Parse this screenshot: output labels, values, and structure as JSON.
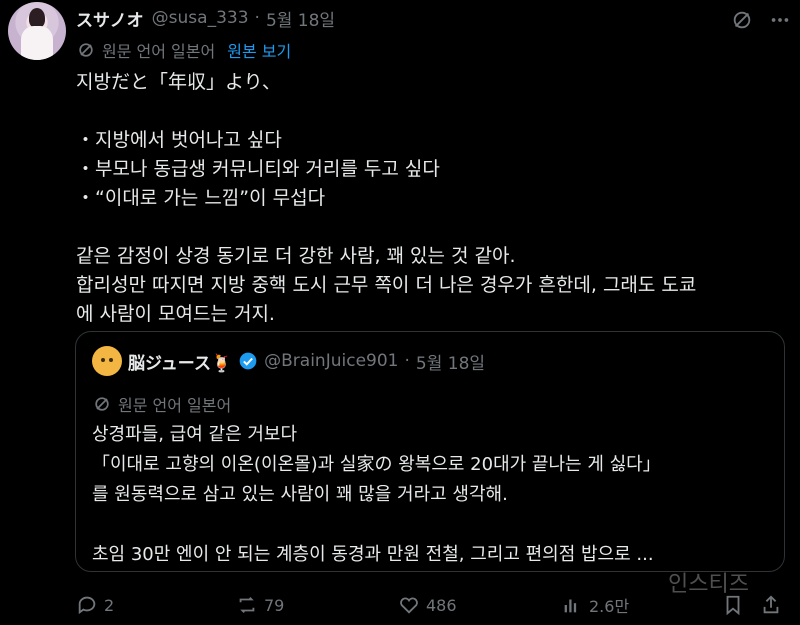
{
  "post": {
    "author_name": "スサノオ",
    "handle": "@susa_333",
    "separator": "·",
    "date": "5월 18일",
    "translate_label": "원문 언어 일본어",
    "view_original": "원본 보기",
    "text": "지방だと「年収」より、\n\n・지방에서 벗어나고 싶다\n・부모나 동급생 커뮤니티와 거리를 두고 싶다\n・“이대로 가는 느낌”이 무섭다\n\n같은 감정이 상경 동기로 더 강한 사람, 꽤 있는 것 같아.\n합리성만 따지면 지방 중핵 도시 근무 쪽이 더 나은 경우가 흔한데, 그래도 도쿄\n에 사람이 모여드는 거지."
  },
  "quote": {
    "author_name": "脳ジュース🍹",
    "handle": "@BrainJuice901",
    "separator": "·",
    "date": "5월 18일",
    "translate_label": "원문 언어 일본어",
    "text": "상경파들, 급여 같은 거보다\n「이대로 고향의 이온(이온몰)과 실家の 왕복으로 20대가 끝나는 게 싫다」\n를 원동력으로 삼고 있는 사람이 꽤 많을 거라고 생각해.\n\n초임 30만 엔이 안 되는 계층이 동경과 만원 전철, 그리고 편의점 밥으로 ..."
  },
  "actions": {
    "replies": "2",
    "reposts": "79",
    "likes": "486",
    "views": "2.6만"
  },
  "watermark": "인스티즈",
  "colors": {
    "background": "#000000",
    "text": "#e7e9ea",
    "muted": "#71767b",
    "link": "#1d9bf0",
    "border": "#2f3336"
  }
}
